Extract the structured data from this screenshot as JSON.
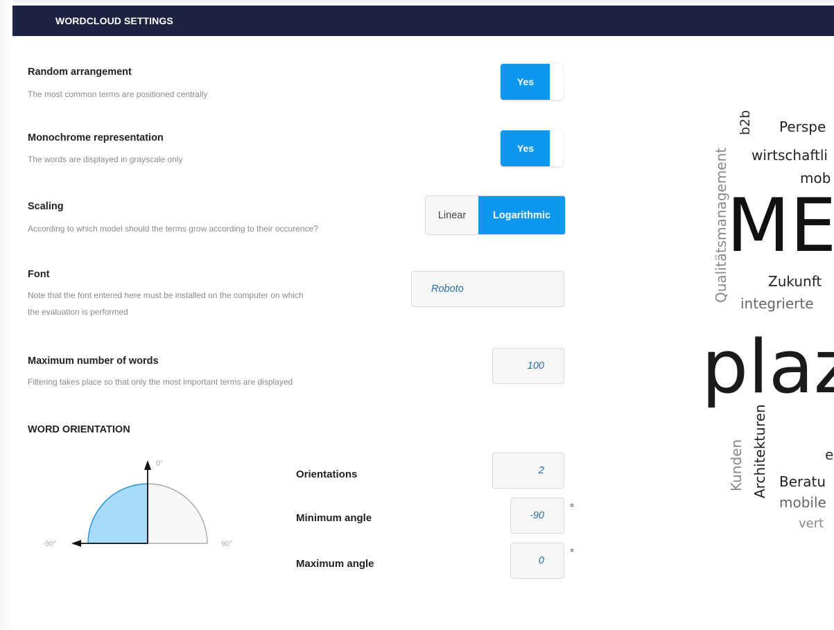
{
  "header": {
    "title": "WORDCLOUD SETTINGS"
  },
  "settings": {
    "random_arrangement": {
      "title": "Random arrangement",
      "desc": "The most common terms are positioned centrally",
      "toggle_label": "Yes"
    },
    "monochrome": {
      "title": "Monochrome representation",
      "desc": "The words are displayed in grayscale only",
      "toggle_label": "Yes"
    },
    "scaling": {
      "title": "Scaling",
      "desc": "According to which model should the terms grow according to their occurence?",
      "options": [
        "Linear",
        "Logarithmic"
      ],
      "selected": "Logarithmic"
    },
    "font": {
      "title": "Font",
      "desc_line1": "Note that the font entered here must be installed on the computer on which",
      "desc_line2": "the evaluation is performed",
      "value": "Roboto"
    },
    "max_words": {
      "title": "Maximum number of words",
      "desc": "Filtering takes place so that only the most important terms are displayed",
      "value": "100"
    }
  },
  "word_orientation": {
    "title": "WORD ORIENTATION",
    "diagram": {
      "top_label": "0°",
      "left_label": "-90°",
      "right_label": "90°"
    },
    "orientations": {
      "label": "Orientations",
      "value": "2"
    },
    "min_angle": {
      "label": "Minimum angle",
      "value": "-90",
      "unit": "°"
    },
    "max_angle": {
      "label": "Maximum angle",
      "value": "0",
      "unit": "°"
    }
  },
  "wordcloud_preview": {
    "words": [
      "b2b",
      "Perspe",
      "wirtschaftli",
      "mob",
      "Qualitätsmanagement",
      "ME",
      "Zukunft",
      "integrierte",
      "plaz",
      "Kunden",
      "Architekturen",
      "e",
      "Beratu",
      "mobile",
      "vert"
    ]
  },
  "colors": {
    "header_bg": "#1e2342",
    "accent": "#0d97ef",
    "field_text": "#1b6fa8"
  }
}
